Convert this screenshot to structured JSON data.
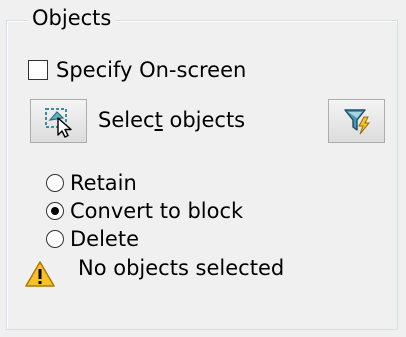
{
  "group": {
    "title": "Objects"
  },
  "specify_onscreen": {
    "label": "Specify On-screen",
    "checked": false
  },
  "select_objects": {
    "label_before": "Selec",
    "label_accel": "t",
    "label_after": " objects",
    "icon": "select-objects-icon"
  },
  "quick_select": {
    "icon": "quick-select-filter-icon"
  },
  "options": [
    {
      "label": "Retain",
      "selected": false
    },
    {
      "label": "Convert to block",
      "selected": true
    },
    {
      "label": "Delete",
      "selected": false
    }
  ],
  "status": {
    "icon": "warning-icon",
    "text": "No objects selected"
  },
  "colors": {
    "background": "#f0f0f0",
    "group_border": "#d5dfe5",
    "warning_yellow": "#f8c12b",
    "icon_teal": "#3a8fa0"
  }
}
